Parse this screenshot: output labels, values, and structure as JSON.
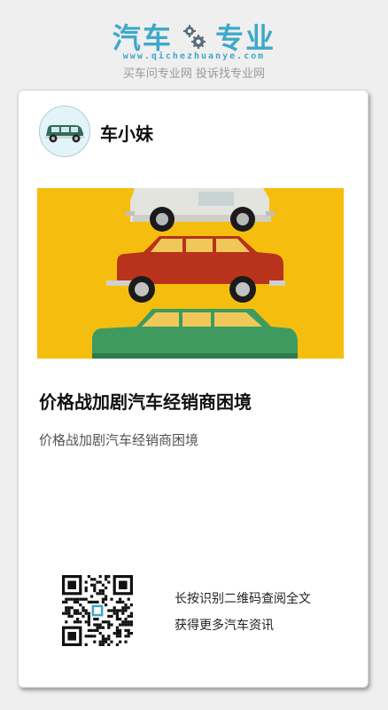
{
  "brand": {
    "logo_left": "汽车",
    "logo_right": "专业",
    "url": "www.qichezhuanye.com",
    "slogan": "买车问专业网 投诉找专业网",
    "logo_icon": "gear-icon",
    "accent_color": "#3fa8c9"
  },
  "post": {
    "author": "车小妹",
    "avatar_icon": "car-avatar-icon",
    "hero_image": "stacked-toy-cars-image",
    "title": "价格战加剧汽车经销商困境",
    "summary": "价格战加剧汽车经销商困境"
  },
  "qr": {
    "icon": "qr-code-icon",
    "line1": "长按识别二维码查阅全文",
    "line2": "获得更多汽车资讯"
  }
}
